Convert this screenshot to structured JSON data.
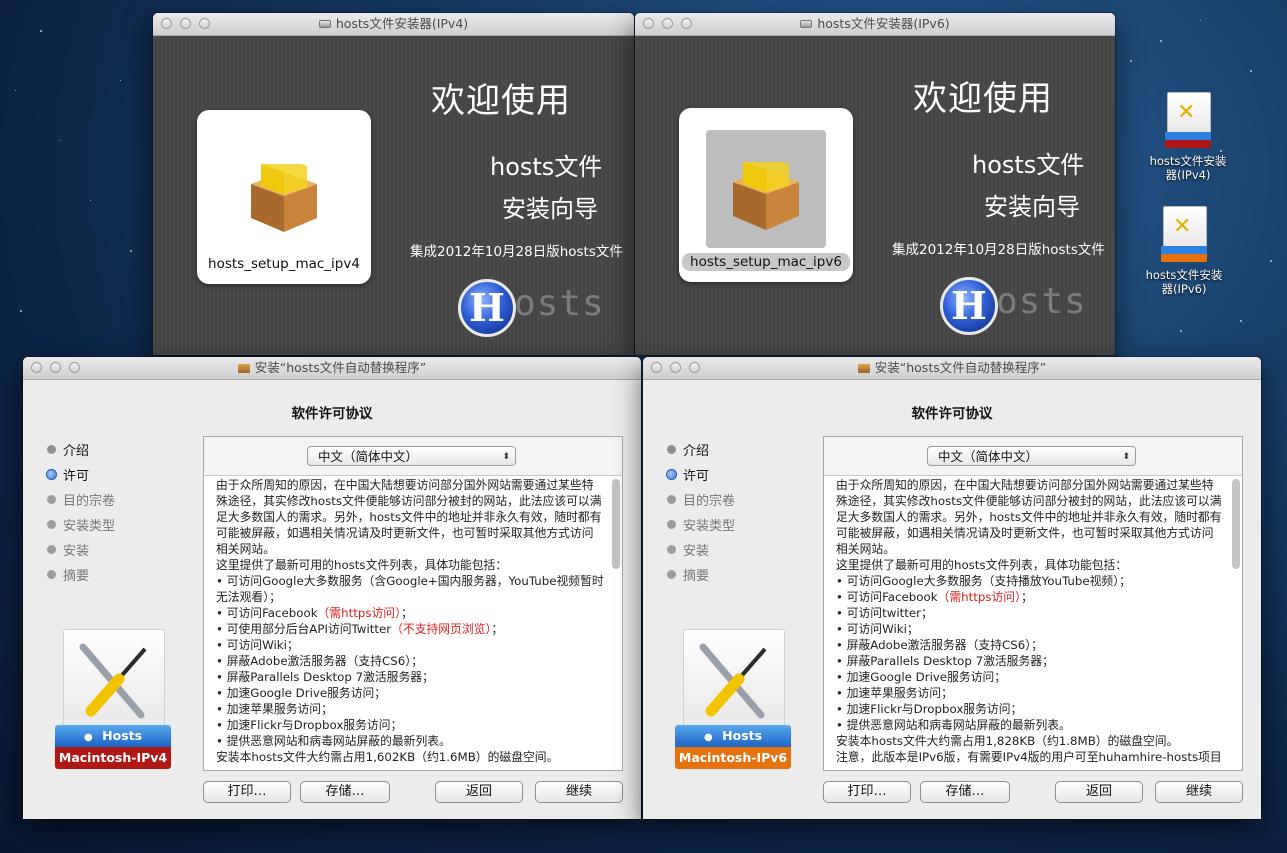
{
  "dmg_windows": [
    {
      "title": "hosts文件安装器(IPv4)",
      "pkg_name": "hosts_setup_mac_ipv4",
      "selected": false,
      "welcome": "欢迎使用",
      "line2": "hosts文件",
      "line3": "安装向导",
      "line4": "集成2012年10月28日版hosts文件",
      "logo_letter": "H",
      "logo_text": "osts"
    },
    {
      "title": "hosts文件安装器(IPv6)",
      "pkg_name": "hosts_setup_mac_ipv6",
      "selected": true,
      "welcome": "欢迎使用",
      "line2": "hosts文件",
      "line3": "安装向导",
      "line4": "集成2012年10月28日版hosts文件",
      "logo_letter": "H",
      "logo_text": "osts"
    }
  ],
  "installers": [
    {
      "title": "安装“hosts文件自动替换程序”",
      "heading": "软件许可协议",
      "steps": [
        "介绍",
        "许可",
        "目的宗卷",
        "安装类型",
        "安装",
        "摘要"
      ],
      "current_step": 1,
      "language": "中文（简体中文）",
      "badge_top": "Hosts",
      "badge_bottom": "Macintosh-IPv4",
      "badge_bottom_color": "#b01818",
      "license": [
        {
          "t": "由于众所周知的原因，在中国大陆想要访问部分国外网站需要通过某些特殊途径，其实修改hosts文件便能够访问部分被封的网站，此法应该可以满足大多数国人的需求。另外，hosts文件中的地址并非永久有效，随时都有可能被屏蔽，如遇相关情况请及时更新文件，也可暂时采取其他方式访问相关网站。"
        },
        {
          "t": "这里提供了最新可用的hosts文件列表，具体功能包括："
        },
        {
          "t": "• 可访问Google大多数服务（含Google+国内服务器，YouTube视频暂时无法观看）；"
        },
        {
          "t": "• 可访问Facebook",
          "r": "（需https访问）",
          "e": "；"
        },
        {
          "t": "• 可使用部分后台API访问Twitter",
          "r": "（不支持网页浏览）",
          "e": "；"
        },
        {
          "t": "• 可访问Wiki；"
        },
        {
          "t": "• 屏蔽Adobe激活服务器（支持CS6）；"
        },
        {
          "t": "• 屏蔽Parallels Desktop 7激活服务器；"
        },
        {
          "t": "• 加速Google Drive服务访问；"
        },
        {
          "t": "• 加速苹果服务访问；"
        },
        {
          "t": "• 加速Flickr与Dropbox服务访问；"
        },
        {
          "t": "• 提供恶意网站和病毒网站屏蔽的最新列表。"
        },
        {
          "t": "安装本hosts文件大约需占用1,602KB（约1.6MB）的磁盘空间。"
        }
      ],
      "buttons": {
        "print": "打印…",
        "save": "存储…",
        "back": "返回",
        "continue": "继续"
      }
    },
    {
      "title": "安装“hosts文件自动替换程序”",
      "heading": "软件许可协议",
      "steps": [
        "介绍",
        "许可",
        "目的宗卷",
        "安装类型",
        "安装",
        "摘要"
      ],
      "current_step": 1,
      "language": "中文（简体中文）",
      "badge_top": "Hosts",
      "badge_bottom": "Macintosh-IPv6",
      "badge_bottom_color": "#e5710f",
      "license": [
        {
          "t": "由于众所周知的原因，在中国大陆想要访问部分国外网站需要通过某些特殊途径，其实修改hosts文件便能够访问部分被封的网站，此法应该可以满足大多数国人的需求。另外，hosts文件中的地址并非永久有效，随时都有可能被屏蔽，如遇相关情况请及时更新文件，也可暂时采取其他方式访问相关网站。"
        },
        {
          "t": "这里提供了最新可用的hosts文件列表，具体功能包括："
        },
        {
          "t": "• 可访问Google大多数服务（支持播放YouTube视频）；"
        },
        {
          "t": "• 可访问Facebook",
          "r": "（需https访问）",
          "e": "；"
        },
        {
          "t": "• 可访问twitter；"
        },
        {
          "t": "• 可访问Wiki；"
        },
        {
          "t": "• 屏蔽Adobe激活服务器（支持CS6）；"
        },
        {
          "t": "• 屏蔽Parallels Desktop 7激活服务器；"
        },
        {
          "t": "• 加速Google Drive服务访问；"
        },
        {
          "t": "• 加速苹果服务访问；"
        },
        {
          "t": "• 加速Flickr与Dropbox服务访问；"
        },
        {
          "t": "• 提供恶意网站和病毒网站屏蔽的最新列表。"
        },
        {
          "t": "安装本hosts文件大约需占用1,828KB（约1.8MB）的磁盘空间。"
        },
        {
          "t": " "
        },
        {
          "t": "注意，此版本是IPv6版，有需要IPv4版的用户可至huhamhire-hosts项目"
        }
      ],
      "buttons": {
        "print": "打印…",
        "save": "存储…",
        "back": "返回",
        "continue": "继续"
      }
    }
  ],
  "desktop_icons": [
    {
      "label": "hosts文件安装器(IPv4)",
      "badge": "Macintosh-IPv4",
      "color": "#b01818"
    },
    {
      "label": "hosts文件安装器(IPv6)",
      "badge": "Macintosh-IPv6",
      "color": "#e5710f"
    }
  ]
}
